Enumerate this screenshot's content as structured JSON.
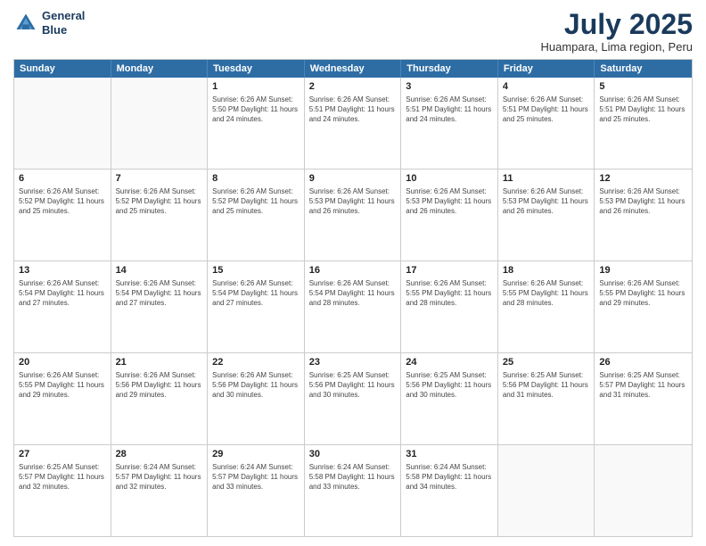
{
  "logo": {
    "line1": "General",
    "line2": "Blue"
  },
  "title": "July 2025",
  "subtitle": "Huampara, Lima region, Peru",
  "header_days": [
    "Sunday",
    "Monday",
    "Tuesday",
    "Wednesday",
    "Thursday",
    "Friday",
    "Saturday"
  ],
  "weeks": [
    [
      {
        "day": "",
        "info": ""
      },
      {
        "day": "",
        "info": ""
      },
      {
        "day": "1",
        "info": "Sunrise: 6:26 AM\nSunset: 5:50 PM\nDaylight: 11 hours and 24 minutes."
      },
      {
        "day": "2",
        "info": "Sunrise: 6:26 AM\nSunset: 5:51 PM\nDaylight: 11 hours and 24 minutes."
      },
      {
        "day": "3",
        "info": "Sunrise: 6:26 AM\nSunset: 5:51 PM\nDaylight: 11 hours and 24 minutes."
      },
      {
        "day": "4",
        "info": "Sunrise: 6:26 AM\nSunset: 5:51 PM\nDaylight: 11 hours and 25 minutes."
      },
      {
        "day": "5",
        "info": "Sunrise: 6:26 AM\nSunset: 5:51 PM\nDaylight: 11 hours and 25 minutes."
      }
    ],
    [
      {
        "day": "6",
        "info": "Sunrise: 6:26 AM\nSunset: 5:52 PM\nDaylight: 11 hours and 25 minutes."
      },
      {
        "day": "7",
        "info": "Sunrise: 6:26 AM\nSunset: 5:52 PM\nDaylight: 11 hours and 25 minutes."
      },
      {
        "day": "8",
        "info": "Sunrise: 6:26 AM\nSunset: 5:52 PM\nDaylight: 11 hours and 25 minutes."
      },
      {
        "day": "9",
        "info": "Sunrise: 6:26 AM\nSunset: 5:53 PM\nDaylight: 11 hours and 26 minutes."
      },
      {
        "day": "10",
        "info": "Sunrise: 6:26 AM\nSunset: 5:53 PM\nDaylight: 11 hours and 26 minutes."
      },
      {
        "day": "11",
        "info": "Sunrise: 6:26 AM\nSunset: 5:53 PM\nDaylight: 11 hours and 26 minutes."
      },
      {
        "day": "12",
        "info": "Sunrise: 6:26 AM\nSunset: 5:53 PM\nDaylight: 11 hours and 26 minutes."
      }
    ],
    [
      {
        "day": "13",
        "info": "Sunrise: 6:26 AM\nSunset: 5:54 PM\nDaylight: 11 hours and 27 minutes."
      },
      {
        "day": "14",
        "info": "Sunrise: 6:26 AM\nSunset: 5:54 PM\nDaylight: 11 hours and 27 minutes."
      },
      {
        "day": "15",
        "info": "Sunrise: 6:26 AM\nSunset: 5:54 PM\nDaylight: 11 hours and 27 minutes."
      },
      {
        "day": "16",
        "info": "Sunrise: 6:26 AM\nSunset: 5:54 PM\nDaylight: 11 hours and 28 minutes."
      },
      {
        "day": "17",
        "info": "Sunrise: 6:26 AM\nSunset: 5:55 PM\nDaylight: 11 hours and 28 minutes."
      },
      {
        "day": "18",
        "info": "Sunrise: 6:26 AM\nSunset: 5:55 PM\nDaylight: 11 hours and 28 minutes."
      },
      {
        "day": "19",
        "info": "Sunrise: 6:26 AM\nSunset: 5:55 PM\nDaylight: 11 hours and 29 minutes."
      }
    ],
    [
      {
        "day": "20",
        "info": "Sunrise: 6:26 AM\nSunset: 5:55 PM\nDaylight: 11 hours and 29 minutes."
      },
      {
        "day": "21",
        "info": "Sunrise: 6:26 AM\nSunset: 5:56 PM\nDaylight: 11 hours and 29 minutes."
      },
      {
        "day": "22",
        "info": "Sunrise: 6:26 AM\nSunset: 5:56 PM\nDaylight: 11 hours and 30 minutes."
      },
      {
        "day": "23",
        "info": "Sunrise: 6:25 AM\nSunset: 5:56 PM\nDaylight: 11 hours and 30 minutes."
      },
      {
        "day": "24",
        "info": "Sunrise: 6:25 AM\nSunset: 5:56 PM\nDaylight: 11 hours and 30 minutes."
      },
      {
        "day": "25",
        "info": "Sunrise: 6:25 AM\nSunset: 5:56 PM\nDaylight: 11 hours and 31 minutes."
      },
      {
        "day": "26",
        "info": "Sunrise: 6:25 AM\nSunset: 5:57 PM\nDaylight: 11 hours and 31 minutes."
      }
    ],
    [
      {
        "day": "27",
        "info": "Sunrise: 6:25 AM\nSunset: 5:57 PM\nDaylight: 11 hours and 32 minutes."
      },
      {
        "day": "28",
        "info": "Sunrise: 6:24 AM\nSunset: 5:57 PM\nDaylight: 11 hours and 32 minutes."
      },
      {
        "day": "29",
        "info": "Sunrise: 6:24 AM\nSunset: 5:57 PM\nDaylight: 11 hours and 33 minutes."
      },
      {
        "day": "30",
        "info": "Sunrise: 6:24 AM\nSunset: 5:58 PM\nDaylight: 11 hours and 33 minutes."
      },
      {
        "day": "31",
        "info": "Sunrise: 6:24 AM\nSunset: 5:58 PM\nDaylight: 11 hours and 34 minutes."
      },
      {
        "day": "",
        "info": ""
      },
      {
        "day": "",
        "info": ""
      }
    ]
  ]
}
